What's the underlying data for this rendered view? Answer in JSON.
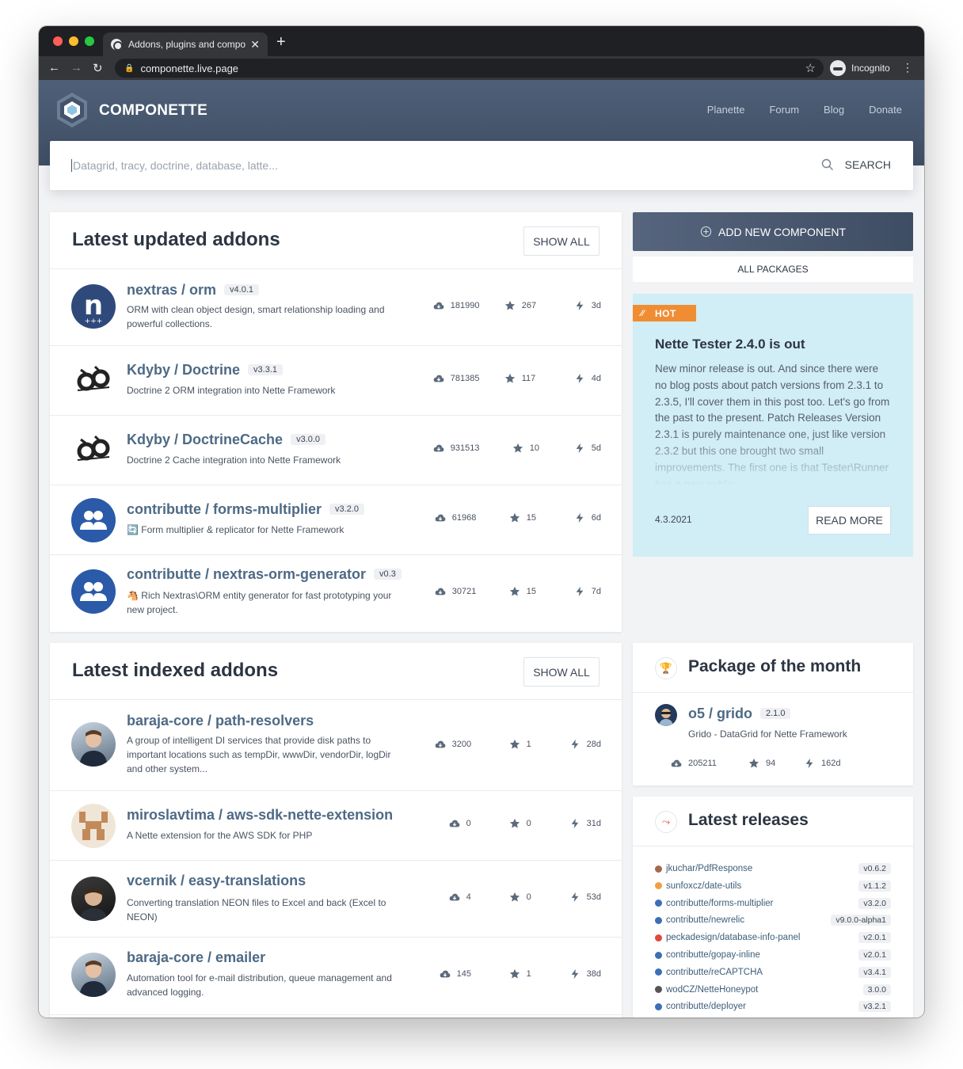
{
  "browser": {
    "tab_title": "Addons, plugins and compone",
    "url": "componette.live.page",
    "incognito_label": "Incognito"
  },
  "site": {
    "brand": "COMPONETTE",
    "nav": [
      "Planette",
      "Forum",
      "Blog",
      "Donate"
    ],
    "search_placeholder": "Datagrid, tracy, doctrine, database, latte...",
    "search_button": "SEARCH"
  },
  "updated": {
    "title": "Latest updated addons",
    "show_all": "SHOW ALL",
    "items": [
      {
        "name": "nextras / orm",
        "version": "v4.0.1",
        "desc": "ORM with clean object design, smart relationship loading and powerful collections.",
        "downloads": "181990",
        "stars": "267",
        "age": "3d"
      },
      {
        "name": "Kdyby / Doctrine",
        "version": "v3.3.1",
        "desc": "Doctrine 2 ORM integration into Nette Framework",
        "downloads": "781385",
        "stars": "117",
        "age": "4d"
      },
      {
        "name": "Kdyby / DoctrineCache",
        "version": "v3.0.0",
        "desc": "Doctrine 2 Cache integration into Nette Framework",
        "downloads": "931513",
        "stars": "10",
        "age": "5d"
      },
      {
        "name": "contributte / forms-multiplier",
        "version": "v3.2.0",
        "desc": "🔄 Form multiplier & replicator for Nette Framework",
        "downloads": "61968",
        "stars": "15",
        "age": "6d"
      },
      {
        "name": "contributte / nextras-orm-generator",
        "version": "v0.3",
        "desc": "🐴 Rich Nextras\\ORM entity generator for fast prototyping your new project.",
        "downloads": "30721",
        "stars": "15",
        "age": "7d"
      }
    ]
  },
  "indexed": {
    "title": "Latest indexed addons",
    "show_all": "SHOW ALL",
    "items": [
      {
        "name": "baraja-core / path-resolvers",
        "desc": "A group of intelligent DI services that provide disk paths to important locations such as tempDir, wwwDir, vendorDir, logDir and other system...",
        "downloads": "3200",
        "stars": "1",
        "age": "28d"
      },
      {
        "name": "miroslavtima / aws-sdk-nette-extension",
        "desc": "A Nette extension for the AWS SDK for PHP",
        "downloads": "0",
        "stars": "0",
        "age": "31d"
      },
      {
        "name": "vcernik / easy-translations",
        "desc": "Converting translation NEON files to Excel and back (Excel to NEON)",
        "downloads": "4",
        "stars": "0",
        "age": "53d"
      },
      {
        "name": "baraja-core / emailer",
        "desc": "Automation tool for e-mail distribution, queue management and advanced logging.",
        "downloads": "145",
        "stars": "1",
        "age": "38d"
      }
    ]
  },
  "sidebar": {
    "add_component": "ADD NEW COMPONENT",
    "all_packages": "ALL PACKAGES",
    "news": {
      "badge": "HOT",
      "title": "Nette Tester 2.4.0 is out",
      "body": "New minor release is out. And since there were no blog posts about patch versions from 2.3.1 to 2.3.5, I'll cover them in this post too. Let's go from the past to the present. Patch Releases Version 2.3.1 is purely maintenance one, just like version 2.3.2 but this one brought two small improvements. The first one is that Tester\\Runner has a new public...",
      "date": "4.3.2021",
      "read_more": "READ MORE"
    },
    "potm": {
      "title": "Package of the month",
      "name": "o5 / grido",
      "version": "2.1.0",
      "desc": "Grido - DataGrid for Nette Framework",
      "downloads": "205211",
      "stars": "94",
      "age": "162d"
    },
    "releases": {
      "title": "Latest releases",
      "items": [
        {
          "name": "jkuchar/PdfResponse",
          "version": "v0.6.2",
          "color": "#a5694f"
        },
        {
          "name": "sunfoxcz/date-utils",
          "version": "v1.1.2",
          "color": "#f0a040"
        },
        {
          "name": "contributte/forms-multiplier",
          "version": "v3.2.0",
          "color": "#3b6fb6"
        },
        {
          "name": "contributte/newrelic",
          "version": "v9.0.0-alpha1",
          "color": "#3b6fb6"
        },
        {
          "name": "peckadesign/database-info-panel",
          "version": "v2.0.1",
          "color": "#e04a3a"
        },
        {
          "name": "contributte/gopay-inline",
          "version": "v2.0.1",
          "color": "#3b6fb6"
        },
        {
          "name": "contributte/reCAPTCHA",
          "version": "v3.4.1",
          "color": "#3b6fb6"
        },
        {
          "name": "wodCZ/NetteHoneypot",
          "version": "3.0.0",
          "color": "#555555"
        },
        {
          "name": "contributte/deployer",
          "version": "v3.2.1",
          "color": "#3b6fb6"
        }
      ]
    }
  }
}
